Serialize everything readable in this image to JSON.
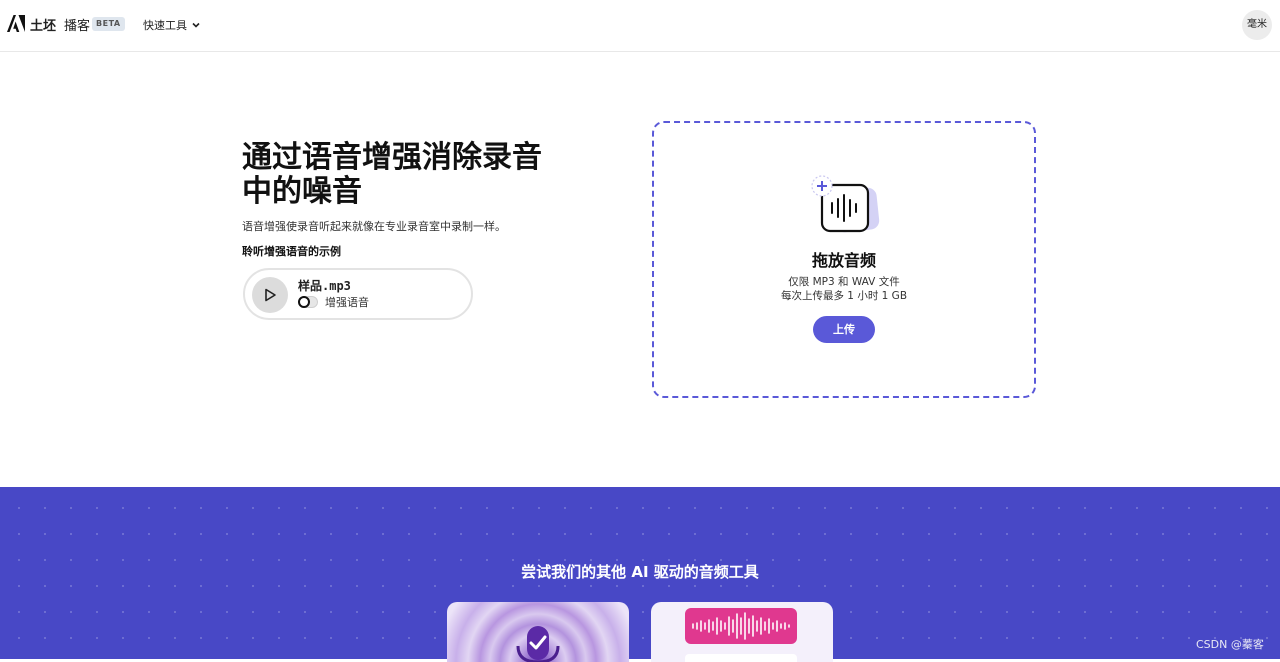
{
  "header": {
    "brand": "土坯",
    "product": "播客",
    "beta_badge": "BETA",
    "quick_tools": "快速工具",
    "avatar_text": "毫米",
    "logo_icon": "adobe-a-logo",
    "chevron_icon": "chevron-down-icon"
  },
  "hero": {
    "title": "通过语音增强消除录音中的噪音",
    "description": "语音增强使录音听起来就像在专业录音室中录制一样。",
    "sample_heading": "聆听增强语音的示例",
    "player": {
      "file_name": "样品.mp3",
      "toggle_label": "增强语音",
      "toggle_on": false,
      "play_icon": "play-icon"
    }
  },
  "dropzone": {
    "title": "拖放音频",
    "line1": "仅限 MP3 和 WAV 文件",
    "line2": "每次上传最多 1 小时 1 GB",
    "button": "上传",
    "icon": "audio-file-add-icon",
    "accent": "#5a59d8"
  },
  "promo": {
    "title": "尝试我们的其他 AI 驱动的音频工具",
    "background": "#4848c6",
    "cards": [
      {
        "icon": "microphone-check-icon"
      },
      {
        "icon": "waveform-icon",
        "accent": "#e0388f"
      }
    ]
  },
  "watermark": "CSDN @蓁客"
}
